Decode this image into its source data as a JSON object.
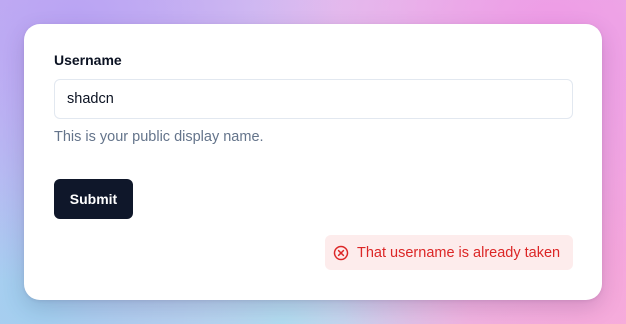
{
  "form": {
    "username_label": "Username",
    "username_value": "shadcn",
    "username_description": "This is your public display name.",
    "submit_label": "Submit"
  },
  "error_toast": {
    "icon": "x-circle-icon",
    "message": "That username is already taken",
    "text_color": "#dc2626",
    "background_color": "#fdecec"
  },
  "colors": {
    "submit_background": "#0f172a",
    "description_text": "#64748b"
  }
}
